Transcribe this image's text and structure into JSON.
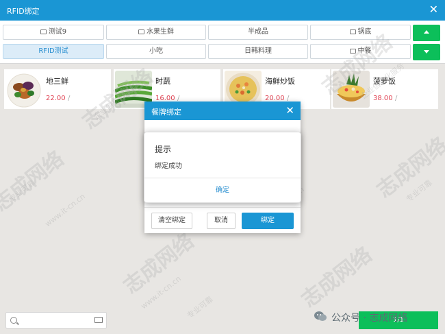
{
  "window": {
    "title": "RFID绑定",
    "close_icon": "close-icon"
  },
  "categories": {
    "row1": [
      {
        "label": "测试9",
        "folder": true
      },
      {
        "label": "水果生鲜",
        "folder": true
      },
      {
        "label": "半成品",
        "folder": false
      },
      {
        "label": "锅底",
        "folder": true
      }
    ],
    "row2": [
      {
        "label": "RFID测试",
        "folder": false,
        "active": true
      },
      {
        "label": "小吃",
        "folder": false
      },
      {
        "label": "日韩料理",
        "folder": false
      },
      {
        "label": "中餐",
        "folder": true
      }
    ],
    "up_icon": "arrow-up-icon",
    "down_icon": "arrow-down-icon"
  },
  "dishes": [
    {
      "name": "地三鲜",
      "price": "22.00",
      "slash": "/"
    },
    {
      "name": "时蔬",
      "price": "16.00",
      "slash": "/"
    },
    {
      "name": "海鲜炒饭",
      "price": "20.00",
      "slash": "/"
    },
    {
      "name": "菠萝饭",
      "price": "38.00",
      "slash": "/"
    }
  ],
  "search": {
    "icon": "search-icon",
    "keyboard_icon": "keyboard-icon"
  },
  "pager": {
    "label": "1/1"
  },
  "dialog": {
    "title": "餐牌绑定",
    "clear_label": "清空绑定",
    "cancel_label": "取消",
    "bind_label": "绑定"
  },
  "alert": {
    "title": "提示",
    "message": "绑定成功",
    "ok_label": "确定"
  },
  "watermark": {
    "brand": "志成网络",
    "url": "www.it-cn.cn",
    "slogan": "专业可靠",
    "slogan2": "企业信息化服务"
  },
  "wechat": {
    "label": "公众号 · 志成网络"
  },
  "colors": {
    "accent": "#1a96d4",
    "green": "#0cbf5a",
    "price": "#e04454"
  }
}
